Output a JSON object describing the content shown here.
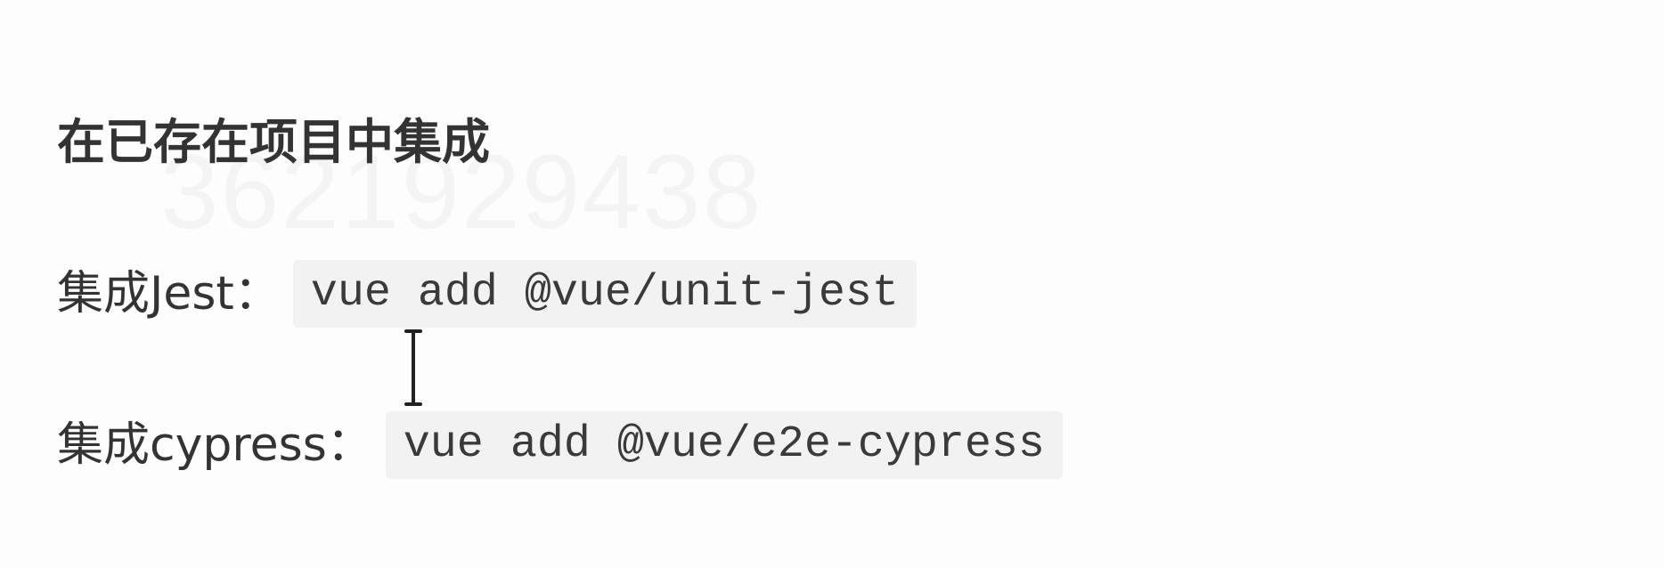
{
  "watermark": "3621929438",
  "heading": "在已存在项目中集成",
  "items": [
    {
      "label": "集成Jest：",
      "command": "vue add @vue/unit-jest"
    },
    {
      "label": "集成cypress：",
      "command": "vue add @vue/e2e-cypress"
    }
  ],
  "cursor": "text-cursor-icon"
}
